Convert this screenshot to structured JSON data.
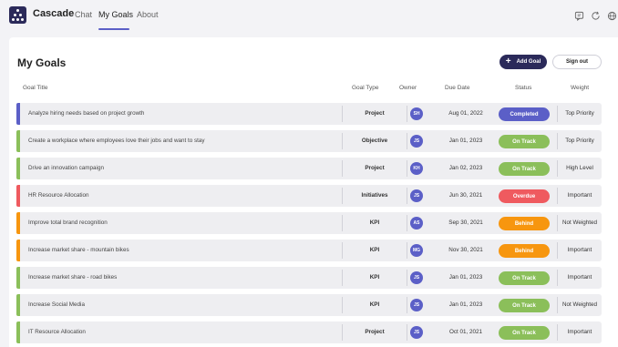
{
  "app": {
    "name": "Cascade"
  },
  "nav": {
    "tabs": [
      {
        "label": "Chat"
      },
      {
        "label": "My Goals"
      },
      {
        "label": "About"
      }
    ]
  },
  "page": {
    "title": "My Goals",
    "add_goal_label": "Add Goal",
    "sign_out_label": "Sign out"
  },
  "table": {
    "headers": {
      "title": "Goal Title",
      "type": "Goal Type",
      "owner": "Owner",
      "due": "Due Date",
      "status": "Status",
      "weight": "Weight"
    },
    "rows": [
      {
        "title": "Analyze hiring needs based on project growth",
        "type": "Project",
        "owner": "SH",
        "due": "Aug 01, 2022",
        "status": "Completed",
        "status_color": "#5b5fc7",
        "bar_color": "#5b5fc7",
        "weight": "Top Priority"
      },
      {
        "title": "Create a workplace where employees love their jobs and want to stay",
        "type": "Objective",
        "owner": "JS",
        "due": "Jan 01, 2023",
        "status": "On Track",
        "status_color": "#8bbf5a",
        "bar_color": "#8bbf5a",
        "weight": "Top Priority"
      },
      {
        "title": "Drive an innovation campaign",
        "type": "Project",
        "owner": "KH",
        "due": "Jan 02, 2023",
        "status": "On Track",
        "status_color": "#8bbf5a",
        "bar_color": "#8bbf5a",
        "weight": "High Level"
      },
      {
        "title": "HR Resource Allocation",
        "type": "Initiatives",
        "owner": "JS",
        "due": "Jun 30, 2021",
        "status": "Overdue",
        "status_color": "#ef5a5f",
        "bar_color": "#ef5a5f",
        "weight": "Important"
      },
      {
        "title": "Improve total brand recognition",
        "type": "KPI",
        "owner": "AS",
        "due": "Sep 30, 2021",
        "status": "Behind",
        "status_color": "#f7960f",
        "bar_color": "#f7960f",
        "weight": "Not Weighted"
      },
      {
        "title": "Increase market share - mountain bikes",
        "type": "KPI",
        "owner": "MG",
        "due": "Nov 30, 2021",
        "status": "Behind",
        "status_color": "#f7960f",
        "bar_color": "#f7960f",
        "weight": "Important"
      },
      {
        "title": "Increase market share - road bikes",
        "type": "KPI",
        "owner": "JS",
        "due": "Jan 01, 2023",
        "status": "On Track",
        "status_color": "#8bbf5a",
        "bar_color": "#8bbf5a",
        "weight": "Important"
      },
      {
        "title": "Increase Social Media",
        "type": "KPI",
        "owner": "JS",
        "due": "Jan 01, 2023",
        "status": "On Track",
        "status_color": "#8bbf5a",
        "bar_color": "#8bbf5a",
        "weight": "Not Weighted"
      },
      {
        "title": "IT Resource Allocation",
        "type": "Project",
        "owner": "JS",
        "due": "Oct 01, 2021",
        "status": "On Track",
        "status_color": "#8bbf5a",
        "bar_color": "#8bbf5a",
        "weight": "Important"
      }
    ]
  },
  "icons": {
    "top_right": [
      "chat-bubble-icon",
      "refresh-icon",
      "globe-icon"
    ]
  }
}
